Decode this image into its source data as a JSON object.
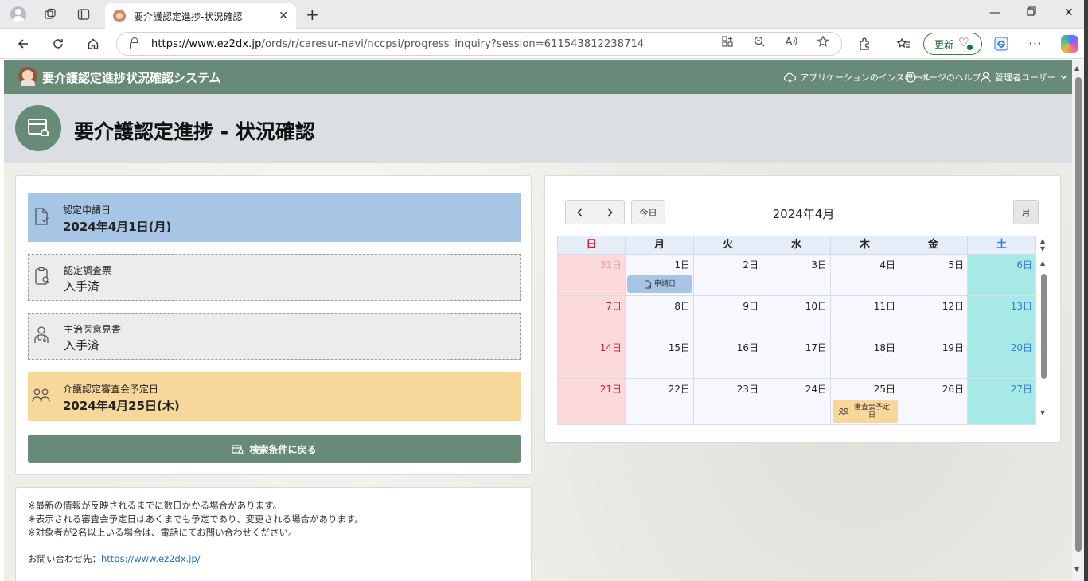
{
  "browser": {
    "tab_title": "要介護認定進捗-状況確認",
    "url_host": "https://www.ez2dx.jp",
    "url_path": "/ords/r/caresur-navi/nccpsi/progress_inquiry?session=611543812238714",
    "update_label": "更新"
  },
  "app": {
    "title": "要介護認定進捗状況確認システム",
    "install_label": "アプリケーションのインストール",
    "help_label": "ページのヘルプ",
    "user_label": "管理者ユーザー"
  },
  "page_title": "要介護認定進捗 - 状況確認",
  "steps": [
    {
      "label": "認定申請日",
      "value": "2024年4月1日(月)",
      "icon": "document-check-icon",
      "color": "#a7c6e6"
    },
    {
      "label": "認定調査票",
      "value": "入手済",
      "icon": "clipboard-search-icon",
      "color": "#ececec"
    },
    {
      "label": "主治医意見書",
      "value": "入手済",
      "icon": "doctor-icon",
      "color": "#ececec"
    },
    {
      "label": "介護認定審査会予定日",
      "value": "2024年4月25日(木)",
      "icon": "users-icon",
      "color": "#f7d79a"
    }
  ],
  "back_button": "検索条件に戻る",
  "notes": {
    "lines": [
      "※最新の情報が反映されるまでに数日かかる場合があります。",
      "※表示される審査会予定日はあくまでも予定であり、変更される場合があります。",
      "※対象者が2名以上いる場合は、電話にてお問い合わせください。"
    ],
    "contact_label": "お問い合わせ先：",
    "contact_link": "https://www.ez2dx.jp/"
  },
  "calendar": {
    "title": "2024年4月",
    "today_label": "今日",
    "month_label": "月",
    "weekdays": [
      "日",
      "月",
      "火",
      "水",
      "木",
      "金",
      "土"
    ],
    "weeks": [
      [
        "31日",
        "1日",
        "2日",
        "3日",
        "4日",
        "5日",
        "6日"
      ],
      [
        "7日",
        "8日",
        "9日",
        "10日",
        "11日",
        "12日",
        "13日"
      ],
      [
        "14日",
        "15日",
        "16日",
        "17日",
        "18日",
        "19日",
        "20日"
      ],
      [
        "21日",
        "22日",
        "23日",
        "24日",
        "25日",
        "26日",
        "27日"
      ]
    ],
    "events": [
      {
        "label": "申請日",
        "week": 0,
        "day": 1,
        "color": "#a7c6e6"
      },
      {
        "label": "審査会予定日",
        "week": 3,
        "day": 4,
        "color": "#f7d79a"
      }
    ]
  }
}
